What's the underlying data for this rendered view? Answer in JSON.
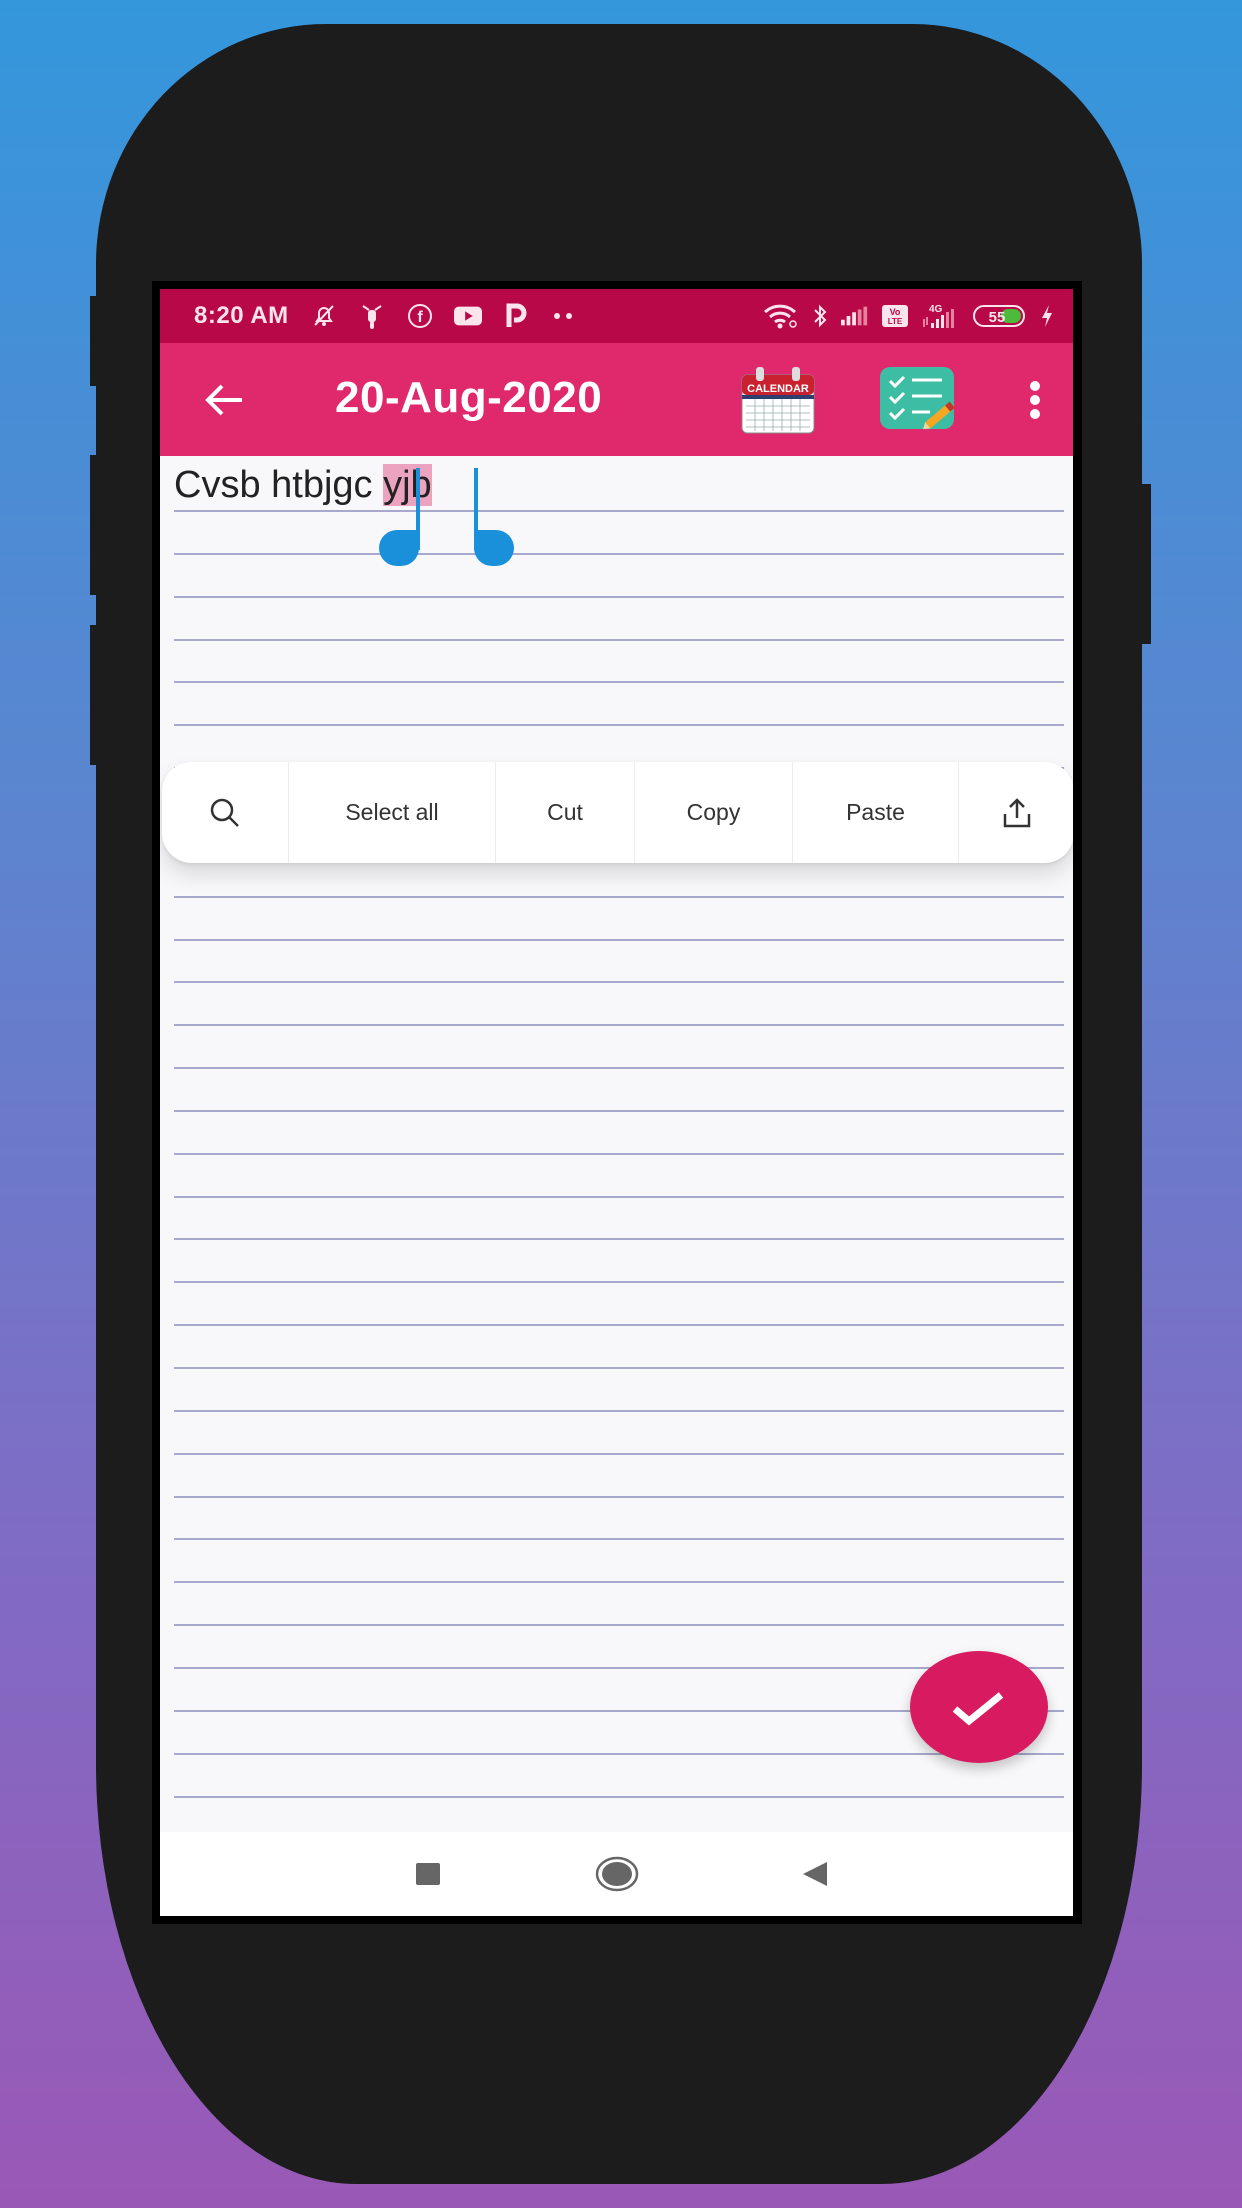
{
  "colors": {
    "status_bar": "#b80847",
    "app_bar": "#e0286c",
    "fab": "#d81b60",
    "selection": "#eca3bf",
    "handle": "#1a8fda",
    "rule_line": "#a8a8cc"
  },
  "status_bar": {
    "time": "8:20 AM",
    "left_icons": [
      "mute-bell-icon",
      "scooter-icon",
      "facebook-icon",
      "youtube-icon",
      "p-app-icon",
      "more-dots-icon"
    ],
    "right_icons": [
      "wifi-icon",
      "bluetooth-icon",
      "signal-icon",
      "volte-icon",
      "4g-signal-icon",
      "battery-icon",
      "charging-icon"
    ],
    "volte_label": "Vo LTE",
    "network_label": "4G",
    "battery_level": "55"
  },
  "app_bar": {
    "title": "20-Aug-2020",
    "calendar_label": "CALENDAR",
    "icons": [
      "back-arrow-icon",
      "calendar-icon",
      "checklist-icon",
      "more-vert-icon"
    ]
  },
  "note": {
    "text_before": "Cvsb htbjgc ",
    "selected_text": "yjb"
  },
  "context_menu": {
    "items": [
      {
        "label": "",
        "icon": "search-icon"
      },
      {
        "label": "Select all"
      },
      {
        "label": "Cut"
      },
      {
        "label": "Copy"
      },
      {
        "label": "Paste"
      },
      {
        "label": "",
        "icon": "share-icon"
      }
    ]
  },
  "fab": {
    "icon": "check-icon"
  },
  "nav_bar": {
    "icons": [
      "recents-square-icon",
      "home-circle-icon",
      "back-triangle-icon"
    ]
  }
}
